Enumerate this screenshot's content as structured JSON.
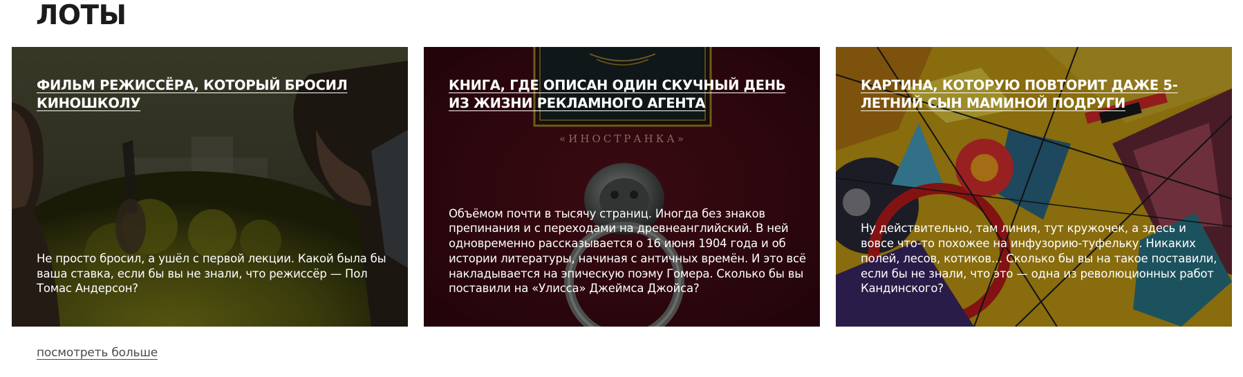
{
  "section": {
    "title": "ЛОТЫ"
  },
  "lots": [
    {
      "title": "ФИЛЬМ РЕЖИССЁРА, КОТОРЫЙ БРОСИЛ КИНОШКОЛУ",
      "description": "Не просто бросил, а ушёл с первой лекции. Какой была бы ваша ставка, если бы вы не знали, что режиссёр — Пол Томас Андерсон?",
      "image": "film-still-two-girls-with-mirror"
    },
    {
      "title": "КНИГА, ГДЕ ОПИСАН ОДИН СКУЧНЫЙ ДЕНЬ ИЗ ЖИЗНИ РЕКЛАМНОГО АГЕНТА",
      "description": "Объёмом почти в тысячу страниц. Иногда без знаков препинания и с переходами на древнеанглийский. В ней одновременно рассказывается о 16 июня 1904 года и об истории литературы, начиная с античных времён. И это всё накладывается на эпическую поэму Гомера. Сколько бы вы поставили на «Улисса» Джеймса Джойса?",
      "image": "book-cover-with-lion-door-knocker",
      "cover_text": "«ИНОСТРАНКА»"
    },
    {
      "title": "КАРТИНА, КОТОРУЮ ПОВТОРИТ ДАЖЕ 5-ЛЕТНИЙ СЫН МАМИНОЙ ПОДРУГИ",
      "description": "Ну действительно, там линия, тут кружочек, а здесь и вовсе что-то похожее на инфузорию-туфельку. Никаких полей, лесов, котиков… Сколько бы вы на такое поставили, если бы не знали, что это — одна из революционных работ Кандинского?",
      "image": "kandinsky-abstract-painting"
    }
  ],
  "more_link": {
    "label": "посмотреть больше"
  },
  "colors": {
    "card_overlay": "#000000",
    "book_cover": "#5a0e1a",
    "text_on_card": "#ffffff"
  }
}
